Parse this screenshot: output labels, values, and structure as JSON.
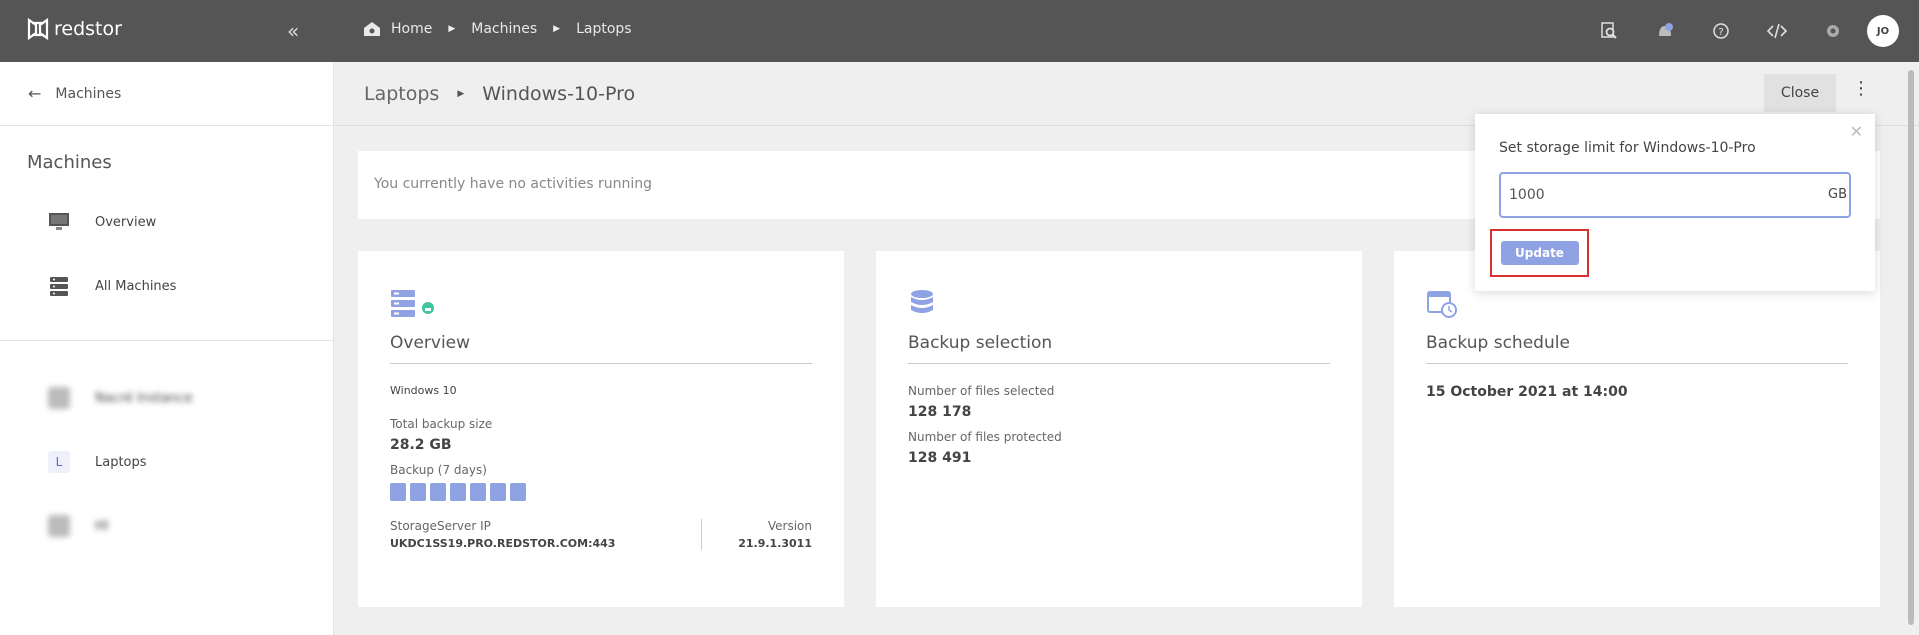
{
  "app": {
    "brand": "redstor",
    "collapse_icon": "«"
  },
  "breadcrumb": {
    "home": "Home",
    "machines": "Machines",
    "laptops": "Laptops"
  },
  "top_icons": [
    "search-doc-icon",
    "notification-icon",
    "help-icon",
    "code-icon",
    "settings-icon"
  ],
  "user": {
    "initials": "JO"
  },
  "sidebar": {
    "back_label": "Machines",
    "title": "Machines",
    "items": [
      {
        "label": "Overview",
        "icon": "monitor-icon"
      },
      {
        "label": "All Machines",
        "icon": "server-stack-icon"
      }
    ],
    "groups": [
      {
        "label": "Nacré Instance",
        "badge": "",
        "blurred": true
      },
      {
        "label": "Laptops",
        "badge": "L",
        "blurred": false
      },
      {
        "label": "HI",
        "badge": "",
        "blurred": true
      }
    ]
  },
  "page": {
    "crumb_parent": "Laptops",
    "crumb_current": "Windows-10-Pro",
    "close_label": "Close"
  },
  "activity": {
    "text": "You currently have no activities running"
  },
  "overview_card": {
    "title": "Overview",
    "os": "Windows 10",
    "total_backup_label": "Total backup size",
    "total_backup_value": "28.2 GB",
    "backup_days_label": "Backup (7 days)",
    "backup_days_count": 7,
    "server_label": "StorageServer IP",
    "server_value": "UKDC1SS19.PRO.REDSTOR.COM:443",
    "version_label": "Version",
    "version_value": "21.9.1.3011"
  },
  "selection_card": {
    "title": "Backup selection",
    "files_selected_label": "Number of files selected",
    "files_selected_value": "128 178",
    "files_protected_label": "Number of files protected",
    "files_protected_value": "128 491"
  },
  "schedule_card": {
    "title": "Backup schedule",
    "value": "15 October 2021 at 14:00"
  },
  "popover": {
    "title": "Set storage limit for Windows-10-Pro",
    "input_value": "1000",
    "unit": "GB",
    "update_label": "Update"
  },
  "colors": {
    "topbar": "#555555",
    "accent": "#8fa2e4",
    "highlight": "#d93030"
  }
}
